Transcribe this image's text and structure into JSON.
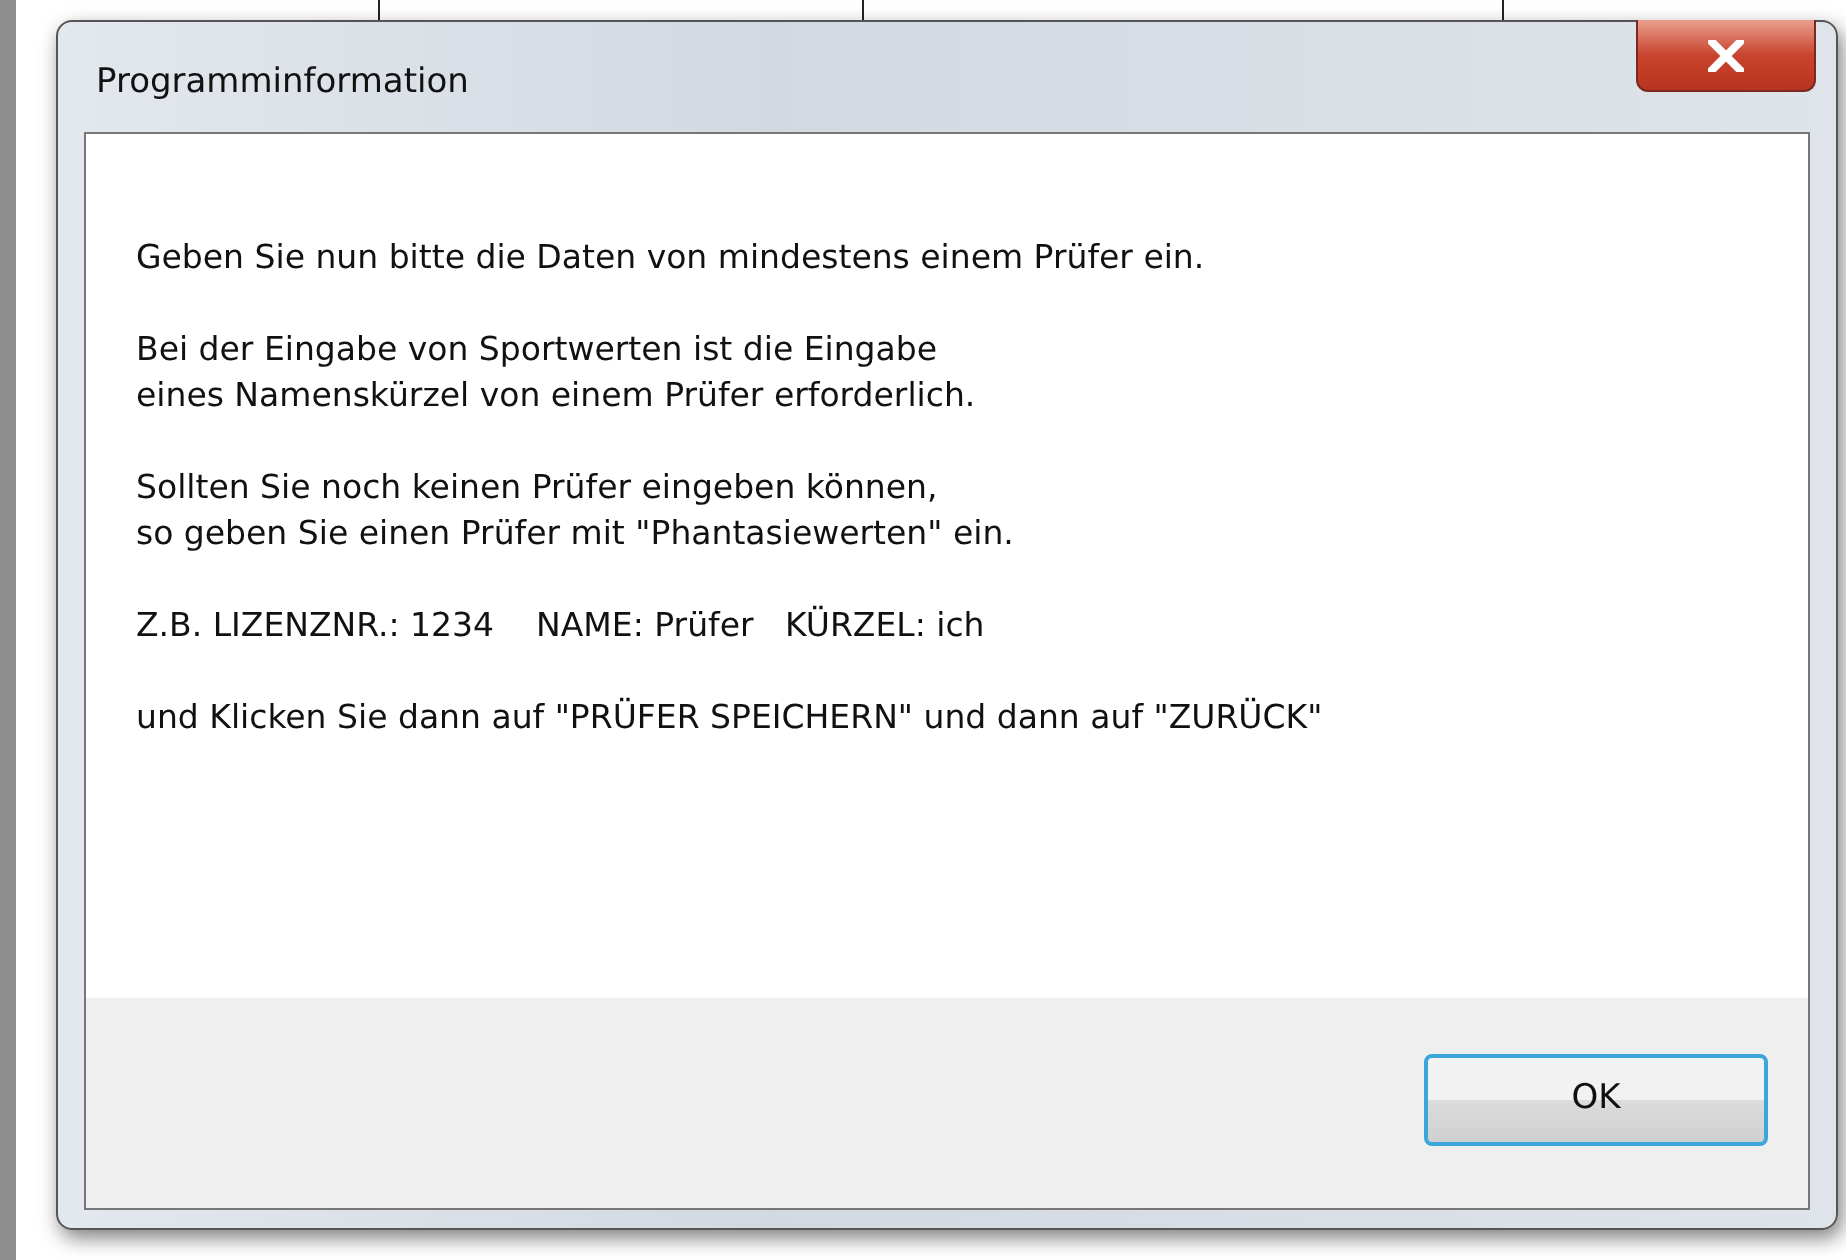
{
  "window": {
    "title": "Programminformation"
  },
  "paragraphs": [
    [
      "Geben Sie nun bitte die Daten von mindestens einem Prüfer ein."
    ],
    [
      "Bei der Eingabe von Sportwerten ist die Eingabe",
      "eines Namenskürzel von einem Prüfer erforderlich."
    ],
    [
      "Sollten Sie noch keinen Prüfer eingeben können,",
      "so geben Sie einen Prüfer mit \"Phantasiewerten\" ein."
    ],
    [
      "Z.B. LIZENZNR.: 1234    NAME: Prüfer   KÜRZEL: ich"
    ],
    [
      "und Klicken Sie dann auf \"PRÜFER SPEICHERN\" und dann auf \"ZURÜCK\""
    ]
  ],
  "buttons": [
    "OK"
  ]
}
